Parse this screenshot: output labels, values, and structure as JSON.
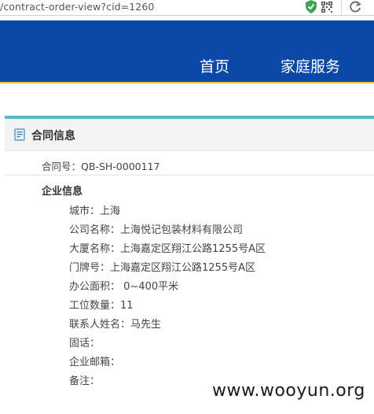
{
  "browser": {
    "url": "/contract-order-view?cid=1260"
  },
  "nav": {
    "items": [
      {
        "label": "首页"
      },
      {
        "label": "家庭服务"
      }
    ]
  },
  "section": {
    "title": "合同信息"
  },
  "contract": {
    "label": "合同号：",
    "value": "QB-SH-0000117"
  },
  "company": {
    "title": "企业信息",
    "fields": [
      {
        "label": "城市：",
        "value": "上海"
      },
      {
        "label": "公司名称：",
        "value": "上海悦记包装材料有限公司"
      },
      {
        "label": "大厦名称：",
        "value": "上海嘉定区翔江公路1255号A区"
      },
      {
        "label": "门牌号：",
        "value": "上海嘉定区翔江公路1255号A区"
      },
      {
        "label": "办公面积：",
        "value": " 0~400平米"
      },
      {
        "label": "工位数量：",
        "value": "11"
      },
      {
        "label": "联系人姓名：",
        "value": "马先生"
      },
      {
        "label": "固话：",
        "value": ""
      },
      {
        "label": "企业邮箱：",
        "value": ""
      },
      {
        "label": "备注：",
        "value": ""
      }
    ]
  },
  "watermark": "www.wooyun.org",
  "colors": {
    "header_blue": "#0a4aa6",
    "accent_yellow": "#e8c23a",
    "teal": "#5fb6c9",
    "shield_green": "#3aa655"
  }
}
